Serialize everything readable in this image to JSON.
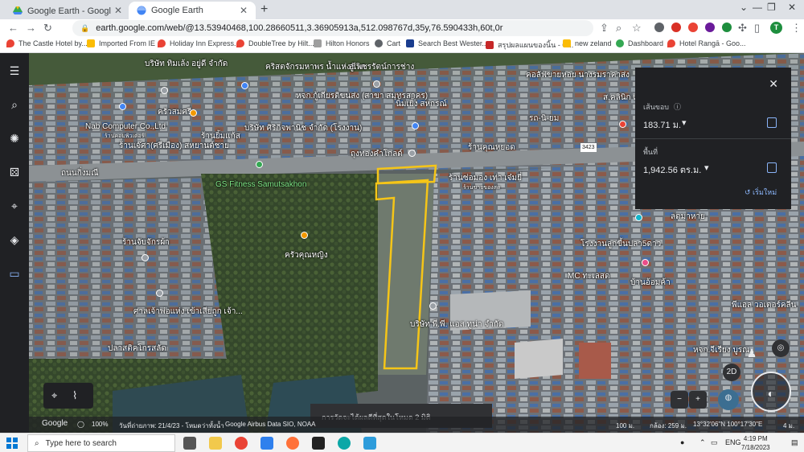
{
  "browser": {
    "tabs": [
      {
        "title": "Google Earth - Google ไดรฟ์",
        "active": false
      },
      {
        "title": "Google Earth",
        "active": true
      }
    ],
    "url": "earth.google.com/web/@13.53940468,100.28660511,3.36905913a,512.098767d,35y,76.590433h,60t,0r",
    "bookmarks": [
      "The Castle Hotel by...",
      "Imported From IE",
      "Holiday Inn Express...",
      "DoubleTree by Hilt...",
      "Hilton Honors",
      "Cart",
      "Search Best Wester...",
      "สรุปผลแผนของนิ้น - C...",
      "new zeland",
      "Dashboard",
      "Hotel Rangā - Goo..."
    ],
    "profile_initial": "T"
  },
  "earth": {
    "measure": {
      "perimeter_label": "เส้นขอบ",
      "perimeter_value": "183.71 ม.",
      "area_label": "พื้นที่",
      "area_value": "1,942.56 ตร.ม.",
      "restart_label": "เริ่มใหม่"
    },
    "map_labels": [
      "บริษัท ทิมเล้ง อยู่ดี จำกัด",
      "คริสตจักรมหาพร น้ำแห่งชีวิต",
      "อู่เพชรรัตน์การช่าง",
      "คอลัฟขายหอย นางรมราคาส่ง",
      "ส.คลินิก แพทย์แผน",
      "ครัวสมศรี",
      "หจก.กู้เกียรติขนส่ง (สาขา สมุทรสาคร)",
      "นิ้มเยิ้ง สหกรณ์",
      "รถ-นิ-ยม",
      "Nab Computer Co.,Ltd",
      "ร้านคอมพิวเตอร์",
      "ร้านยิ้มแก้ส",
      "บริษัท ศิริกิจพานิช จำกัด (โรงงาน)",
      "ร้านเจ๊ศา(ศรีเมือง) สหยานต์ชาย",
      "ถุงทองคำโกลด์",
      "ร้านคุณหยอด",
      "ถนนกิ่งมณี",
      "GS Fitness Samutsakhon",
      "ร้านซ่อมอง เท่า เจ๋มยี่",
      "ร้านขายของสด",
      "ร้านจับจักรผ้า",
      "ครัวคุณหญิง",
      "โรงงานลูกขี้นปลา5ดาว",
      "MC ทะเลสด",
      "บ้านอ้อมค้า",
      "ลดมาหาย",
      "ศาลเจ้าพ่อแห่ง เข้าเสียถูก เจ้า...",
      "บริษัท พี.พี. แอส.ทูน่า จำกัด",
      "พีแอล วอเตอร์คลีน",
      "ปลาสติคโกรสลัด",
      "หจก.จีเรียง บูรณ",
      "3423"
    ],
    "status": {
      "zoom_pct": "100%",
      "imagery_date": "วันที่ถ่ายภาพ: 21/4/23 - โหมดว่าทั้งน้ำ",
      "data_sources": "Google  Airbus  Data SIO, NOAA",
      "toast": "การวัดจะได้ผลดีที่สุดในโหมด 2 มิติ",
      "scale": "100 ม.",
      "camera": "กล้อง: 259 ม.",
      "coords": "13°32'06\"N 100°17'30\"E",
      "elevation": "4 ม."
    },
    "view_toggle": "2D",
    "google_label": "Google"
  },
  "taskbar": {
    "search_placeholder": "Type here to search",
    "lang": "ENG",
    "time": "4:19 PM",
    "date": "7/18/2023"
  },
  "colors": {
    "polygon": "#f5c518",
    "accent": "#8ab4f8",
    "panel": "#202124"
  }
}
